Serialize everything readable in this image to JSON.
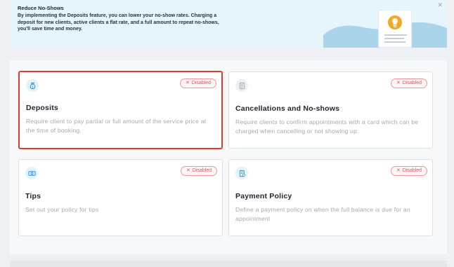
{
  "banner": {
    "title": "Reduce No-Shows",
    "text": "By implementing the Deposits feature, you can lower your no-show rates. Charging a deposit for new clients, active clients a flat rate, and a full amount to repeat no-shows, you'll save time and money.",
    "close_icon": "close-icon",
    "illustration_icon": "lightbulb-icon",
    "colors": {
      "background": "#e6f5fb",
      "wave": "#a9d4ea",
      "bulb": "#f3a81f"
    }
  },
  "cards": [
    {
      "icon": "money-bag-icon",
      "status": "Disabled",
      "title": "Deposits",
      "description": "Require client to pay partial or full amount of the service price at the time of booking."
    },
    {
      "icon": "document-icon",
      "status": "Disabled",
      "title": "Cancellations and No-shows",
      "description": "Require clients to confirm appointments with a card which can be charged when cancelling or not showing up."
    },
    {
      "icon": "cash-icon",
      "status": "Disabled",
      "title": "Tips",
      "description": "Set out your policy for tips"
    },
    {
      "icon": "receipt-icon",
      "status": "Disabled",
      "title": "Payment Policy",
      "description": "Define a payment policy on when the full balance is due for an appointment"
    }
  ],
  "colors": {
    "disabled_badge": "#e3545f",
    "highlight_border": "#e23a2f",
    "icon_accent": "#2b8fc7"
  }
}
